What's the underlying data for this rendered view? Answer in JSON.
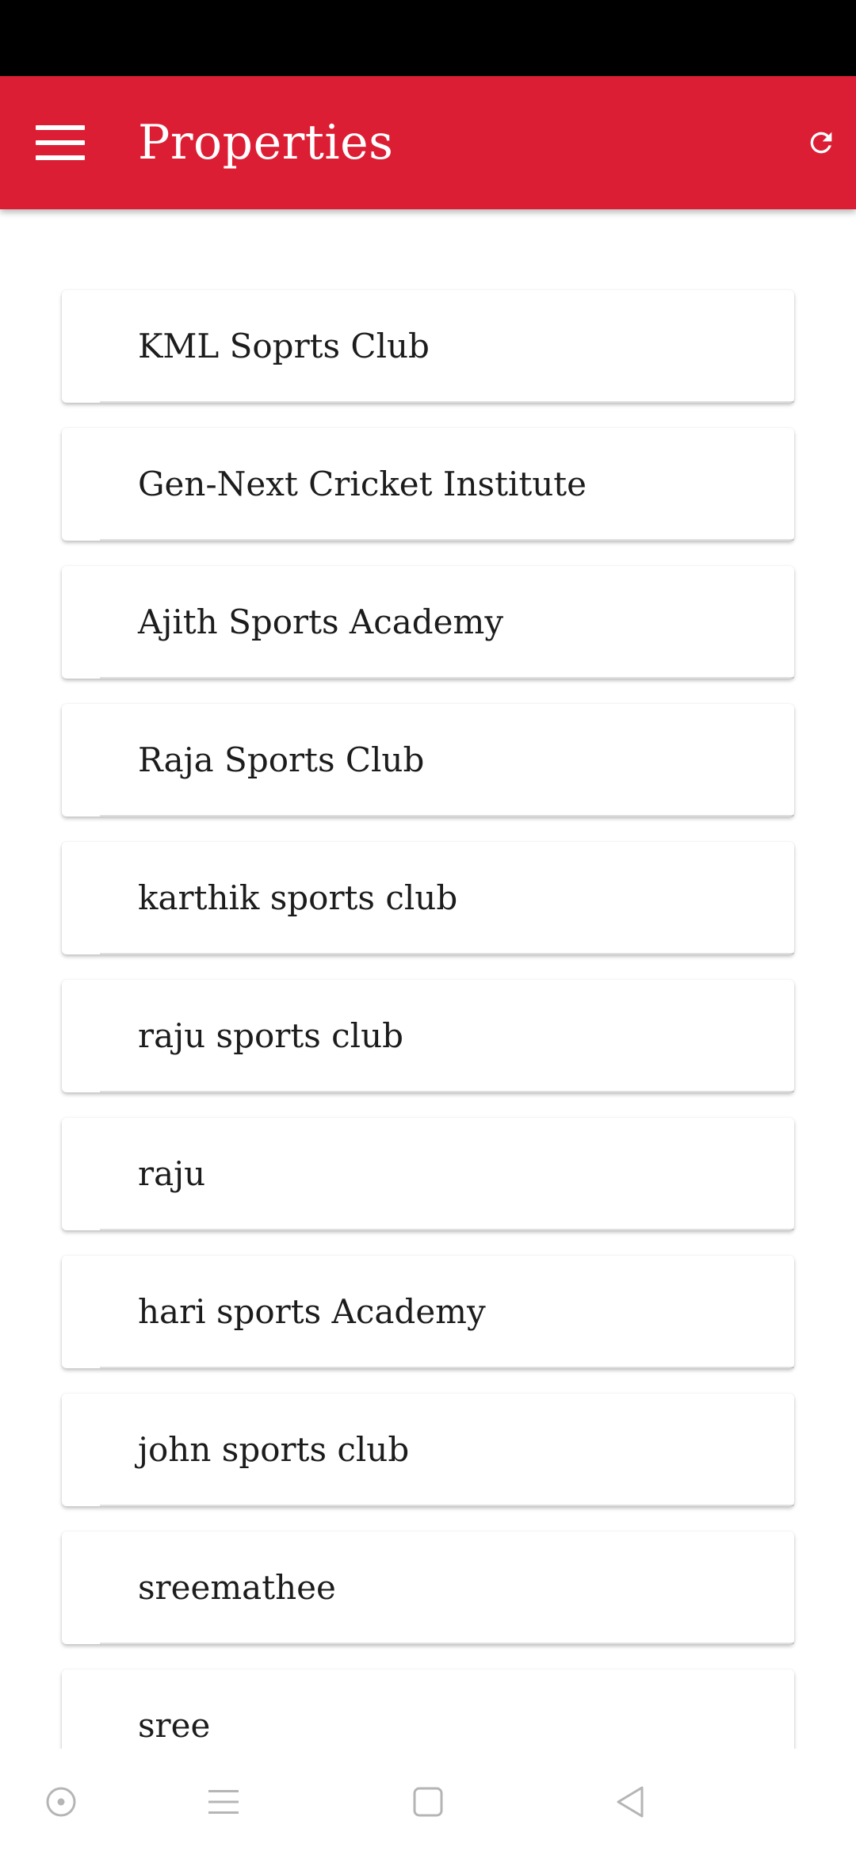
{
  "app_bar": {
    "title": "Properties",
    "background_color": "#dc1e34",
    "left_icon": "menu-icon",
    "right_icon": "refresh-icon"
  },
  "properties": [
    {
      "name": "KML Soprts Club"
    },
    {
      "name": "Gen-Next Cricket Institute"
    },
    {
      "name": "Ajith Sports Academy"
    },
    {
      "name": "Raja Sports Club"
    },
    {
      "name": "karthik sports club"
    },
    {
      "name": "raju sports club"
    },
    {
      "name": "raju"
    },
    {
      "name": "hari sports Academy"
    },
    {
      "name": "john sports club"
    },
    {
      "name": "sreemathee"
    },
    {
      "name": "sree"
    }
  ],
  "nav_bar": {
    "icons": [
      "assistant-icon",
      "recents-icon",
      "home-icon",
      "back-icon"
    ]
  }
}
